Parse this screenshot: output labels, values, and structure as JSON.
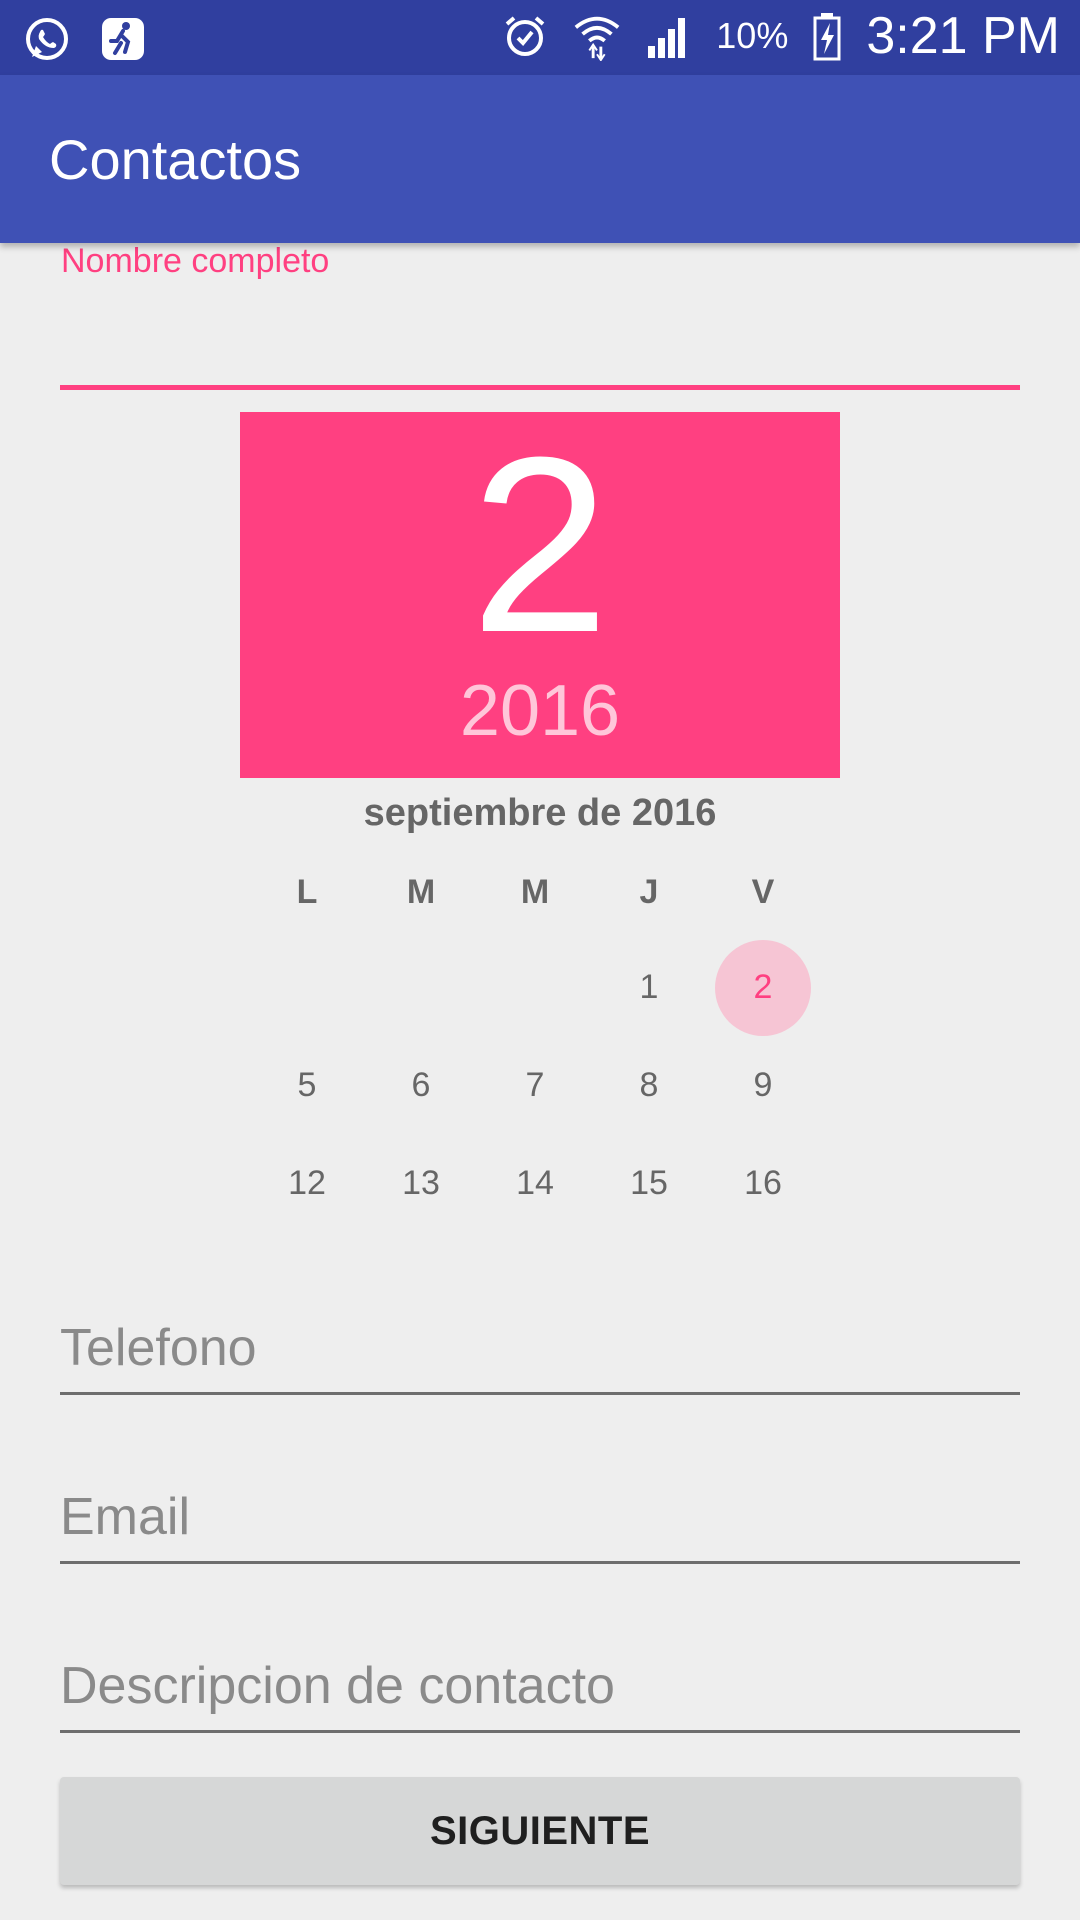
{
  "status_bar": {
    "icons_left": [
      "whatsapp-icon",
      "running-app-icon"
    ],
    "icons_right": [
      "alarm-icon",
      "wifi-icon",
      "signal-icon",
      "battery-charging-icon"
    ],
    "battery": "10%",
    "time": "3:21 PM"
  },
  "app_bar": {
    "title": "Contactos"
  },
  "form": {
    "name_label": "Nombre completo",
    "name_value": "",
    "phone_placeholder": "Telefono",
    "email_placeholder": "Email",
    "description_placeholder": "Descripcion de contacto",
    "next_button": "SIGUIENTE"
  },
  "date_picker": {
    "selected_day": "2",
    "selected_year": "2016",
    "month_label": "septiembre de 2016",
    "weekdays": [
      "L",
      "M",
      "M",
      "J",
      "V"
    ],
    "weeks": [
      [
        "",
        "",
        "",
        "1",
        "2"
      ],
      [
        "5",
        "6",
        "7",
        "8",
        "9"
      ],
      [
        "12",
        "13",
        "14",
        "15",
        "16"
      ]
    ],
    "selected_index": [
      0,
      4
    ]
  },
  "colors": {
    "status_bar": "#303f9f",
    "app_bar": "#3f51b5",
    "accent": "#ff4081",
    "background": "#eeeeee"
  }
}
